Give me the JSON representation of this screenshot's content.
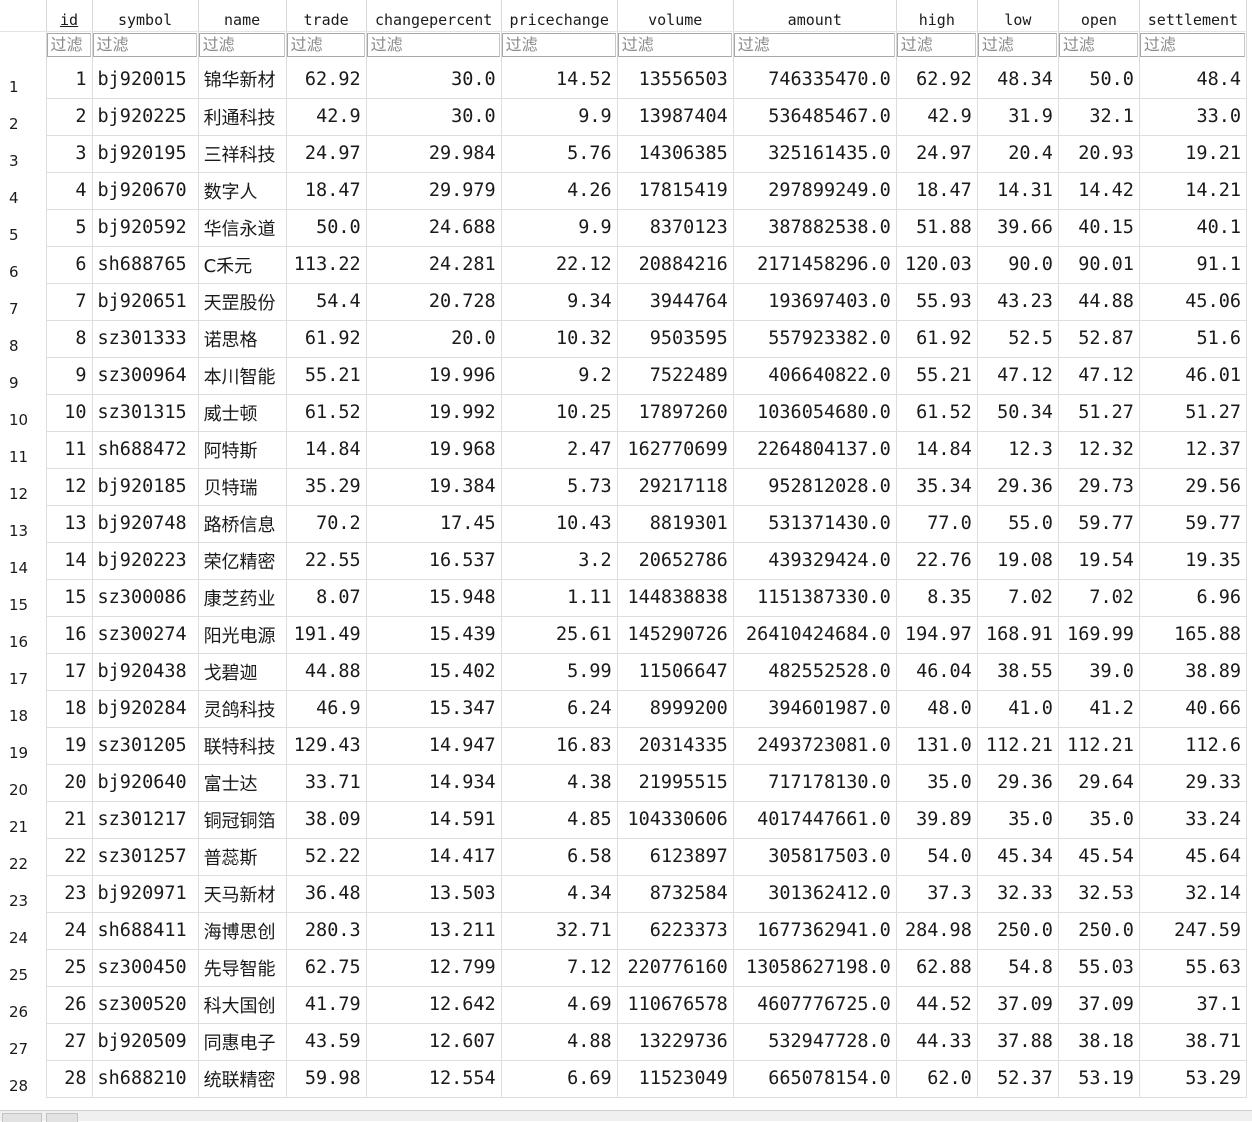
{
  "columns": [
    {
      "key": "id",
      "label": "id"
    },
    {
      "key": "symbol",
      "label": "symbol"
    },
    {
      "key": "name",
      "label": "name"
    },
    {
      "key": "trade",
      "label": "trade"
    },
    {
      "key": "changepercent",
      "label": "changepercent"
    },
    {
      "key": "pricechange",
      "label": "pricechange"
    },
    {
      "key": "volume",
      "label": "volume"
    },
    {
      "key": "amount",
      "label": "amount"
    },
    {
      "key": "high",
      "label": "high"
    },
    {
      "key": "low",
      "label": "low"
    },
    {
      "key": "open",
      "label": "open"
    },
    {
      "key": "settlement",
      "label": "settlement"
    }
  ],
  "filter_placeholder": "过滤",
  "rows": [
    {
      "rownum": "1",
      "cells": [
        "1",
        "bj920015",
        "锦华新材",
        "62.92",
        "30.0",
        "14.52",
        "13556503",
        "746335470.0",
        "62.92",
        "48.34",
        "50.0",
        "48.4"
      ]
    },
    {
      "rownum": "2",
      "cells": [
        "2",
        "bj920225",
        "利通科技",
        "42.9",
        "30.0",
        "9.9",
        "13987404",
        "536485467.0",
        "42.9",
        "31.9",
        "32.1",
        "33.0"
      ]
    },
    {
      "rownum": "3",
      "cells": [
        "3",
        "bj920195",
        "三祥科技",
        "24.97",
        "29.984",
        "5.76",
        "14306385",
        "325161435.0",
        "24.97",
        "20.4",
        "20.93",
        "19.21"
      ]
    },
    {
      "rownum": "4",
      "cells": [
        "4",
        "bj920670",
        "数字人",
        "18.47",
        "29.979",
        "4.26",
        "17815419",
        "297899249.0",
        "18.47",
        "14.31",
        "14.42",
        "14.21"
      ]
    },
    {
      "rownum": "5",
      "cells": [
        "5",
        "bj920592",
        "华信永道",
        "50.0",
        "24.688",
        "9.9",
        "8370123",
        "387882538.0",
        "51.88",
        "39.66",
        "40.15",
        "40.1"
      ]
    },
    {
      "rownum": "6",
      "cells": [
        "6",
        "sh688765",
        "C禾元",
        "113.22",
        "24.281",
        "22.12",
        "20884216",
        "2171458296.0",
        "120.03",
        "90.0",
        "90.01",
        "91.1"
      ]
    },
    {
      "rownum": "7",
      "cells": [
        "7",
        "bj920651",
        "天罡股份",
        "54.4",
        "20.728",
        "9.34",
        "3944764",
        "193697403.0",
        "55.93",
        "43.23",
        "44.88",
        "45.06"
      ]
    },
    {
      "rownum": "8",
      "cells": [
        "8",
        "sz301333",
        "诺思格",
        "61.92",
        "20.0",
        "10.32",
        "9503595",
        "557923382.0",
        "61.92",
        "52.5",
        "52.87",
        "51.6"
      ]
    },
    {
      "rownum": "9",
      "cells": [
        "9",
        "sz300964",
        "本川智能",
        "55.21",
        "19.996",
        "9.2",
        "7522489",
        "406640822.0",
        "55.21",
        "47.12",
        "47.12",
        "46.01"
      ]
    },
    {
      "rownum": "10",
      "cells": [
        "10",
        "sz301315",
        "威士顿",
        "61.52",
        "19.992",
        "10.25",
        "17897260",
        "1036054680.0",
        "61.52",
        "50.34",
        "51.27",
        "51.27"
      ]
    },
    {
      "rownum": "11",
      "cells": [
        "11",
        "sh688472",
        "阿特斯",
        "14.84",
        "19.968",
        "2.47",
        "162770699",
        "2264804137.0",
        "14.84",
        "12.3",
        "12.32",
        "12.37"
      ]
    },
    {
      "rownum": "12",
      "cells": [
        "12",
        "bj920185",
        "贝特瑞",
        "35.29",
        "19.384",
        "5.73",
        "29217118",
        "952812028.0",
        "35.34",
        "29.36",
        "29.73",
        "29.56"
      ]
    },
    {
      "rownum": "13",
      "cells": [
        "13",
        "bj920748",
        "路桥信息",
        "70.2",
        "17.45",
        "10.43",
        "8819301",
        "531371430.0",
        "77.0",
        "55.0",
        "59.77",
        "59.77"
      ]
    },
    {
      "rownum": "14",
      "cells": [
        "14",
        "bj920223",
        "荣亿精密",
        "22.55",
        "16.537",
        "3.2",
        "20652786",
        "439329424.0",
        "22.76",
        "19.08",
        "19.54",
        "19.35"
      ]
    },
    {
      "rownum": "15",
      "cells": [
        "15",
        "sz300086",
        "康芝药业",
        "8.07",
        "15.948",
        "1.11",
        "144838838",
        "1151387330.0",
        "8.35",
        "7.02",
        "7.02",
        "6.96"
      ]
    },
    {
      "rownum": "16",
      "cells": [
        "16",
        "sz300274",
        "阳光电源",
        "191.49",
        "15.439",
        "25.61",
        "145290726",
        "26410424684.0",
        "194.97",
        "168.91",
        "169.99",
        "165.88"
      ]
    },
    {
      "rownum": "17",
      "cells": [
        "17",
        "bj920438",
        "戈碧迦",
        "44.88",
        "15.402",
        "5.99",
        "11506647",
        "482552528.0",
        "46.04",
        "38.55",
        "39.0",
        "38.89"
      ]
    },
    {
      "rownum": "18",
      "cells": [
        "18",
        "bj920284",
        "灵鸽科技",
        "46.9",
        "15.347",
        "6.24",
        "8999200",
        "394601987.0",
        "48.0",
        "41.0",
        "41.2",
        "40.66"
      ]
    },
    {
      "rownum": "19",
      "cells": [
        "19",
        "sz301205",
        "联特科技",
        "129.43",
        "14.947",
        "16.83",
        "20314335",
        "2493723081.0",
        "131.0",
        "112.21",
        "112.21",
        "112.6"
      ]
    },
    {
      "rownum": "20",
      "cells": [
        "20",
        "bj920640",
        "富士达",
        "33.71",
        "14.934",
        "4.38",
        "21995515",
        "717178130.0",
        "35.0",
        "29.36",
        "29.64",
        "29.33"
      ]
    },
    {
      "rownum": "21",
      "cells": [
        "21",
        "sz301217",
        "铜冠铜箔",
        "38.09",
        "14.591",
        "4.85",
        "104330606",
        "4017447661.0",
        "39.89",
        "35.0",
        "35.0",
        "33.24"
      ]
    },
    {
      "rownum": "22",
      "cells": [
        "22",
        "sz301257",
        "普蕊斯",
        "52.22",
        "14.417",
        "6.58",
        "6123897",
        "305817503.0",
        "54.0",
        "45.34",
        "45.54",
        "45.64"
      ]
    },
    {
      "rownum": "23",
      "cells": [
        "23",
        "bj920971",
        "天马新材",
        "36.48",
        "13.503",
        "4.34",
        "8732584",
        "301362412.0",
        "37.3",
        "32.33",
        "32.53",
        "32.14"
      ]
    },
    {
      "rownum": "24",
      "cells": [
        "24",
        "sh688411",
        "海博思创",
        "280.3",
        "13.211",
        "32.71",
        "6223373",
        "1677362941.0",
        "284.98",
        "250.0",
        "250.0",
        "247.59"
      ]
    },
    {
      "rownum": "25",
      "cells": [
        "25",
        "sz300450",
        "先导智能",
        "62.75",
        "12.799",
        "7.12",
        "220776160",
        "13058627198.0",
        "62.88",
        "54.8",
        "55.03",
        "55.63"
      ]
    },
    {
      "rownum": "26",
      "cells": [
        "26",
        "sz300520",
        "科大国创",
        "41.79",
        "12.642",
        "4.69",
        "110676578",
        "4607776725.0",
        "44.52",
        "37.09",
        "37.09",
        "37.1"
      ]
    },
    {
      "rownum": "27",
      "cells": [
        "27",
        "bj920509",
        "同惠电子",
        "43.59",
        "12.607",
        "4.88",
        "13229736",
        "532947728.0",
        "44.33",
        "37.88",
        "38.18",
        "38.71"
      ]
    },
    {
      "rownum": "28",
      "cells": [
        "28",
        "sh688210",
        "统联精密",
        "59.98",
        "12.554",
        "6.69",
        "11523049",
        "665078154.0",
        "62.0",
        "52.37",
        "53.19",
        "53.29"
      ]
    }
  ]
}
